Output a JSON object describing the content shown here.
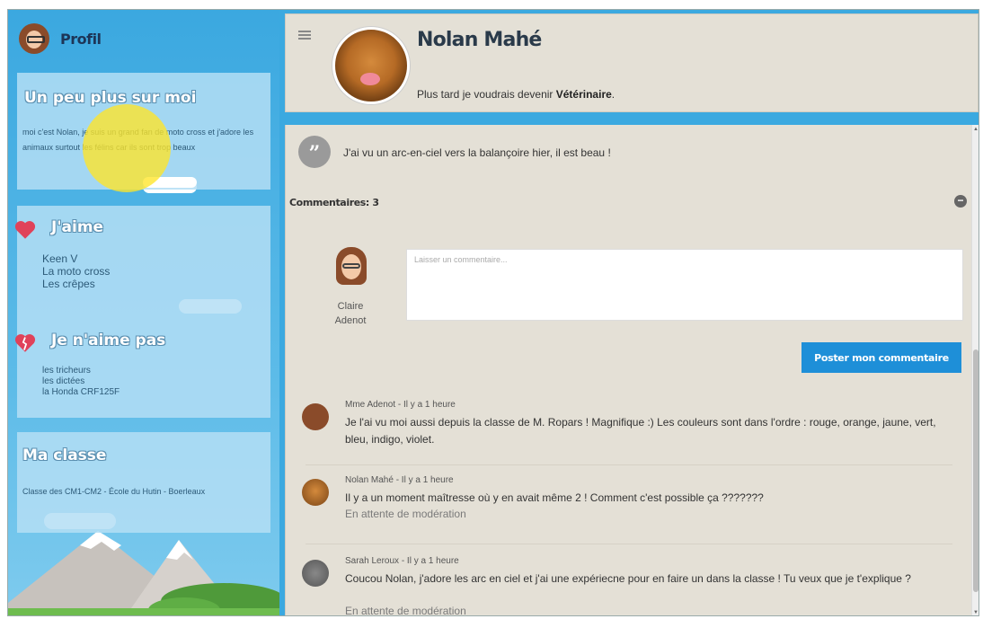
{
  "sidebar": {
    "profile_title": "Profil",
    "about": {
      "title": "Un peu plus sur moi",
      "text": "moi c'est Nolan, je suis un grand fan de moto cross et j'adore les animaux surtout les félins car ils sont trop beaux"
    },
    "likes": {
      "title": "J'aime",
      "items": [
        "Keen V",
        "La moto cross",
        "Les crêpes"
      ]
    },
    "dislikes": {
      "title": "Je n'aime pas",
      "items": [
        "les tricheurs",
        "les dictées",
        "la Honda CRF125F"
      ]
    },
    "class": {
      "title": "Ma classe",
      "text": "Classe des CM1-CM2 - École du Hutin - Boerleaux"
    }
  },
  "header": {
    "name": "Nolan Mahé",
    "bio_prefix": "Plus tard je voudrais devenir ",
    "bio_job": "Vétérinaire",
    "bio_suffix": "."
  },
  "post": {
    "text": "J'ai vu un arc-en-ciel vers la balançoire hier, il est beau !"
  },
  "comments_section": {
    "count_label": "Commentaires: 3",
    "toggle_symbol": "−",
    "composer": {
      "first_name": "Claire",
      "last_name": "Adenot",
      "placeholder": "Laisser un commentaire...",
      "submit_label": "Poster mon commentaire"
    },
    "comments": [
      {
        "meta": "Mme Adenot - Il y a 1 heure",
        "body": "Je l'ai vu moi aussi depuis la classe de M. Ropars ! Magnifique :) Les couleurs sont dans l'ordre : rouge, orange, jaune, vert, bleu, indigo, violet.",
        "status": ""
      },
      {
        "meta": "Nolan Mahé - Il y a 1 heure",
        "body": "Il y a un moment maîtresse où y en avait même 2 ! Comment c'est possible ça ???????",
        "status": "En attente de modération"
      },
      {
        "meta": "Sarah Leroux - Il y a 1 heure",
        "body": "Coucou Nolan, j'adore les arc en ciel et j'ai une expériecne pour en faire un dans la classe ! Tu veux que je t'explique ?",
        "status": "En attente de modération"
      }
    ]
  },
  "icons": {
    "menu": "hamburger-icon",
    "quote": "quote-icon",
    "heart_like": "heart-icon",
    "heart_dislike": "broken-heart-icon"
  },
  "colors": {
    "sky": "#3ba9e0",
    "card": "#b4def5",
    "panel": "#e4e0d6",
    "button": "#1e8fd8",
    "heart": "#e0425a"
  }
}
